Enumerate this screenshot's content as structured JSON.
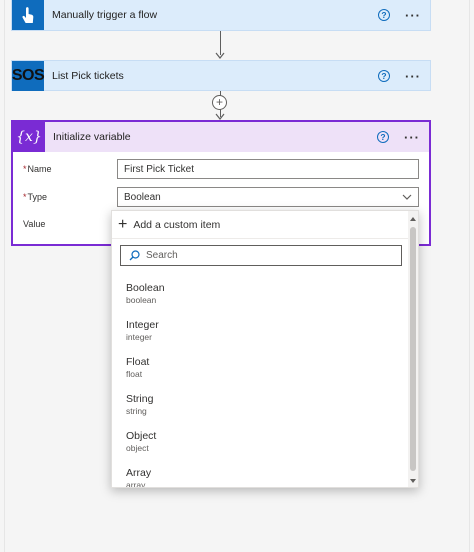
{
  "flow": {
    "trigger": {
      "title": "Manually trigger a flow",
      "icon": "touch-hand-icon"
    },
    "list_action": {
      "title": "List Pick tickets",
      "icon_text": "SOS"
    },
    "variable_action": {
      "title": "Initialize variable",
      "icon_text": "{x}",
      "fields": {
        "name_label": "Name",
        "name_value": "First Pick Ticket",
        "type_label": "Type",
        "type_value": "Boolean",
        "value_label": "Value"
      }
    },
    "help_symbol": "?",
    "more_symbol": "···",
    "required_mark": "*",
    "plus_symbol": "+"
  },
  "dropdown": {
    "add_custom_label": "Add a custom item",
    "search_placeholder": "Search",
    "options": [
      {
        "label": "Boolean",
        "sub": "boolean"
      },
      {
        "label": "Integer",
        "sub": "integer"
      },
      {
        "label": "Float",
        "sub": "float"
      },
      {
        "label": "String",
        "sub": "string"
      },
      {
        "label": "Object",
        "sub": "object"
      },
      {
        "label": "Array",
        "sub": "array"
      }
    ]
  },
  "colors": {
    "action_blue": "#0f6cbd",
    "variable_purple": "#7a2bd4",
    "card_bg": "#dcecfb",
    "variable_header_bg": "#eee1f8"
  }
}
